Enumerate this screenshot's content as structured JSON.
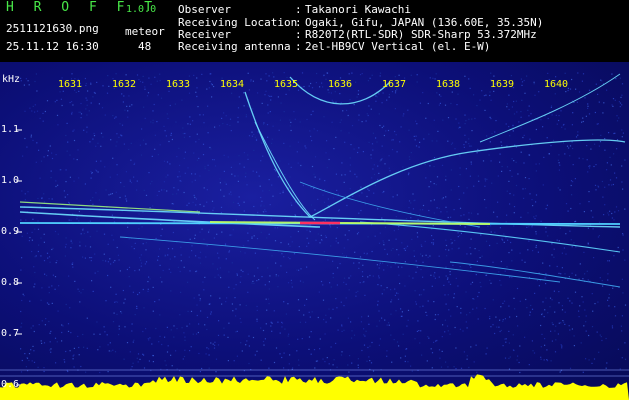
{
  "app": {
    "title": "H R O F F T",
    "version": "1.0.0"
  },
  "file": {
    "name": "2511121630.png",
    "datetime": "25.11.12 16:30"
  },
  "meteor": {
    "label": "meteor",
    "count": "48"
  },
  "info": [
    {
      "label": "Observer",
      "value": "Takanori Kawachi"
    },
    {
      "label": "Receiving Location",
      "value": "Ogaki, Gifu, JAPAN (136.60E, 35.35N)"
    },
    {
      "label": "Receiver",
      "value": "R820T2(RTL-SDR) SDR-Sharp 53.372MHz"
    },
    {
      "label": "Receiving antenna",
      "value": "2el-HB9CV Vertical (el. E-W)"
    }
  ],
  "axis": {
    "y_unit": "kHz",
    "time_ticks": [
      "1631",
      "1632",
      "1633",
      "1634",
      "1635",
      "1636",
      "1637",
      "1638",
      "1639",
      "1640"
    ],
    "freq_ticks": [
      "1.1",
      "1.0",
      "0.9",
      "0.8",
      "0.7",
      "0.6"
    ]
  },
  "colors": {
    "header_title": "#48e848",
    "header_text": "#ffffff",
    "tick_labels": "#ffff00",
    "background": "#0c0f78",
    "noise_floor": "#ffff00"
  }
}
